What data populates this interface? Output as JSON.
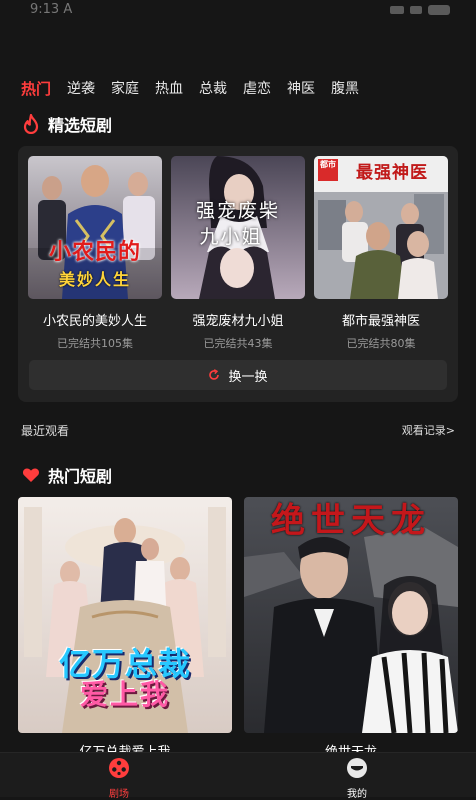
{
  "status": {
    "time": "9:13 A"
  },
  "tabs": [
    "热门",
    "逆袭",
    "家庭",
    "热血",
    "总裁",
    "虐恋",
    "神医",
    "腹黑"
  ],
  "featured": {
    "title": "精选短剧",
    "items": [
      {
        "title": "小农民的美妙人生",
        "meta": "已完结共105集",
        "poster_text": [
          "小农民的",
          "美妙人生"
        ]
      },
      {
        "title": "强宠废材九小姐",
        "meta": "已完结共43集",
        "poster_text": [
          "强宠废柴",
          "九小姐"
        ]
      },
      {
        "title": "都市最强神医",
        "meta": "已完结共80集",
        "poster_text": [
          "最强神医",
          "都市"
        ]
      }
    ],
    "refresh_label": "换一换"
  },
  "recent": {
    "label": "最近观看",
    "link": "观看记录>"
  },
  "hot": {
    "title": "热门短剧",
    "items": [
      {
        "title": "亿万总裁爱上我",
        "poster_text": [
          "亿万总裁",
          "爱上我"
        ]
      },
      {
        "title": "绝世天龙",
        "poster_text": [
          "绝世天龙"
        ]
      }
    ]
  },
  "nav": {
    "items": [
      {
        "label": "剧场"
      },
      {
        "label": "我的"
      }
    ]
  },
  "colors": {
    "accent": "#ff3d3d",
    "background": "#161616",
    "panel": "#232323"
  }
}
